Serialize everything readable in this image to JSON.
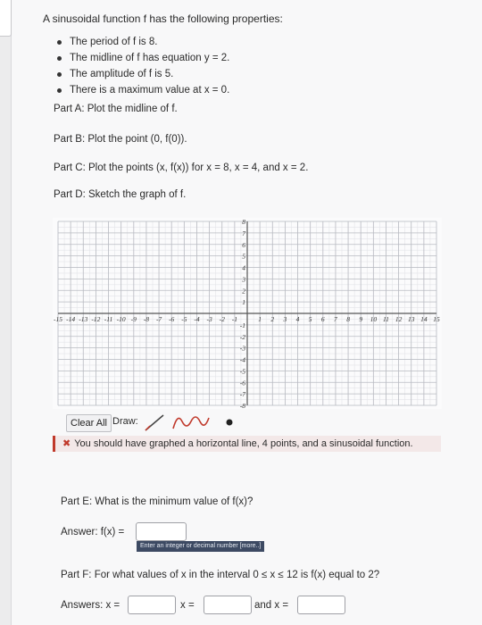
{
  "intro": "A sinusoidal function f has the following properties:",
  "properties": [
    "The period of f is 8.",
    "The midline of f has equation y = 2.",
    "The amplitude of f is 5.",
    "There is a maximum value at x = 0."
  ],
  "parts": {
    "a": "Part A: Plot the midline of f.",
    "b": "Part B: Plot the point (0, f(0)).",
    "c": "Part C: Plot the points (x, f(x)) for x = 8, x = 4, and x = 2.",
    "d": "Part D: Sketch the graph of f.",
    "e": "Part E: What is the minimum value of f(x)?",
    "f": "Part F: For what values of x in the interval 0 ≤ x ≤ 12 is f(x) equal to 2?"
  },
  "graph": {
    "x_range": [
      -15,
      15
    ],
    "y_range": [
      -8,
      8
    ],
    "x_ticks": [
      "-15",
      "-14",
      "-13",
      "-12",
      "-11",
      "-10",
      "-9",
      "-8",
      "-7",
      "-6",
      "-5",
      "-4",
      "-3",
      "-2",
      "-1",
      "1",
      "2",
      "3",
      "4",
      "5",
      "6",
      "7",
      "8",
      "9",
      "10",
      "11",
      "12",
      "13",
      "14",
      "15"
    ],
    "y_ticks": [
      "8",
      "7",
      "6",
      "5",
      "4",
      "3",
      "2",
      "1",
      "-1",
      "-2",
      "-3",
      "-4",
      "-5",
      "-6",
      "-7",
      "-8"
    ],
    "grid": true
  },
  "toolbar": {
    "clear_label": "Clear All",
    "draw_label": "Draw:",
    "tools": [
      "line-tool-icon",
      "sine-wave-tool-icon",
      "point-tool-icon"
    ]
  },
  "feedback": {
    "icon": "error-x-icon",
    "text": "You should have graphed a horizontal line, 4 points, and a sinusoidal function.",
    "color": "#c0392b"
  },
  "answers": {
    "e_label": "Answer: f(x) =",
    "e_hint": "Enter an integer or decimal number [more..]",
    "f_label": "Answers: x =",
    "f_mid": "x =",
    "f_and": "and x ="
  }
}
